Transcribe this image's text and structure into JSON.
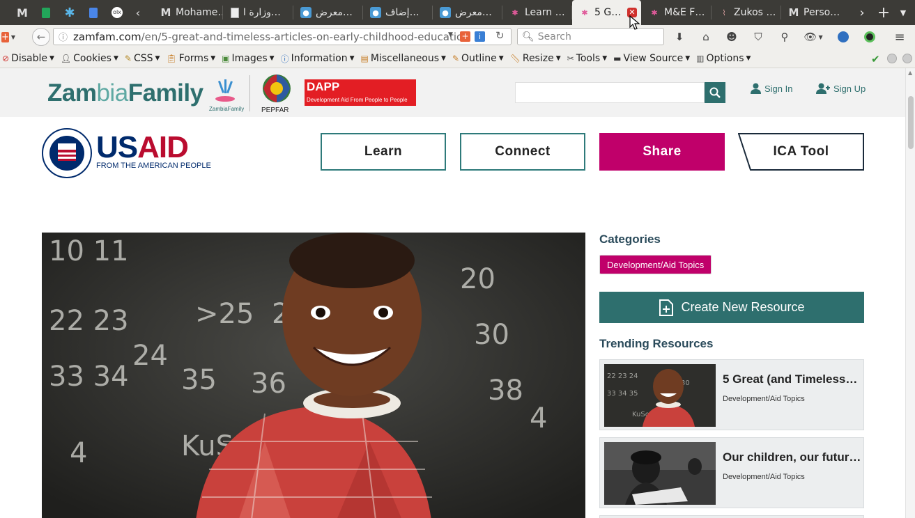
{
  "browser": {
    "tabs": [
      {
        "label": "Mohame…"
      },
      {
        "label": "وزارة ا…"
      },
      {
        "label": "معرض…"
      },
      {
        "label": "إضاف…"
      },
      {
        "label": "معرض…"
      },
      {
        "label": "Learn …"
      },
      {
        "label": "5 G…"
      },
      {
        "label": "M&E F…"
      },
      {
        "label": "Zukos …"
      },
      {
        "label": "Perso…"
      }
    ],
    "url_host": "zamfam.com",
    "url_path": "/en/5-great-and-timeless-articles-on-early-childhood-education",
    "search_placeholder": "Search",
    "devtools": [
      {
        "label": "Disable",
        "icon": "disable-icon"
      },
      {
        "label": "Cookies",
        "icon": "cookie-icon"
      },
      {
        "label": "CSS",
        "icon": "pencil-icon"
      },
      {
        "label": "Forms",
        "icon": "clipboard-icon"
      },
      {
        "label": "Images",
        "icon": "image-icon"
      },
      {
        "label": "Information",
        "icon": "info-icon"
      },
      {
        "label": "Miscellaneous",
        "icon": "box-icon"
      },
      {
        "label": "Outline",
        "icon": "pencil-icon"
      },
      {
        "label": "Resize",
        "icon": "ruler-icon"
      },
      {
        "label": "Tools",
        "icon": "wrench-icon"
      },
      {
        "label": "View Source",
        "icon": "monitor-icon"
      },
      {
        "label": "Options",
        "icon": "options-icon"
      }
    ]
  },
  "site": {
    "logo_main": "Zam",
    "logo_mid": "bia",
    "logo_end": "Family",
    "small_logo_label": "ZambiaFamily",
    "pepfar_label": "PEPFAR",
    "dapp_title": "DAPP",
    "dapp_subtitle": "Development Aid From People to People",
    "sign_in": "Sign In",
    "sign_up": "Sign Up",
    "usaid_us": "US",
    "usaid_aid": "AID",
    "usaid_sub": "FROM THE AMERICAN PEOPLE",
    "nav": {
      "learn": "Learn",
      "connect": "Connect",
      "share": "Share",
      "ica": "ICA Tool"
    }
  },
  "sidebar": {
    "categories_heading": "Categories",
    "category_badge": "Development/Aid Topics",
    "create_button": "Create New Resource",
    "trending_heading": "Trending Resources",
    "resources": [
      {
        "title": "5 Great (and Timeless…",
        "category": "Development/Aid Topics"
      },
      {
        "title": "Our children, our futur…",
        "category": "Development/Aid Topics"
      }
    ]
  },
  "colors": {
    "teal": "#2e6f6e",
    "magenta": "#c0006a",
    "usaid_blue": "#002a6c",
    "usaid_red": "#ba0c2f"
  }
}
